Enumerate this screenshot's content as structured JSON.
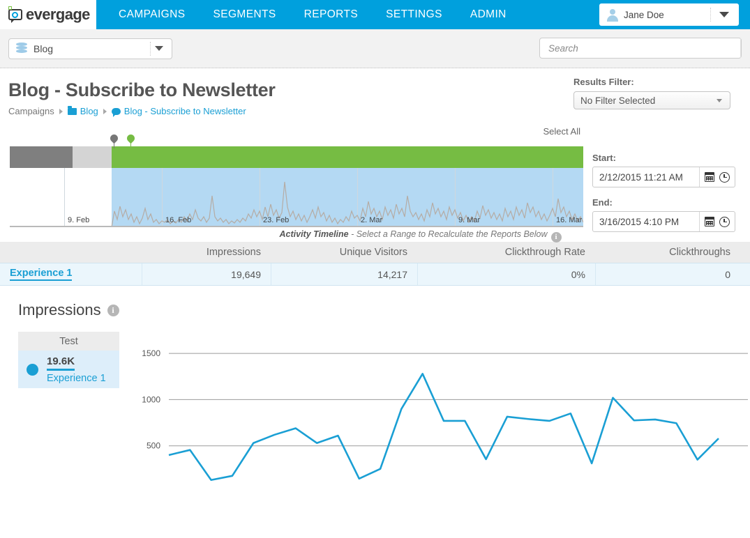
{
  "brand": {
    "name": "evergage",
    "accent": "#00a0dd",
    "green": "#7ac143"
  },
  "topnav": {
    "items": [
      "CAMPAIGNS",
      "SEGMENTS",
      "REPORTS",
      "SETTINGS",
      "ADMIN"
    ],
    "user": "Jane Doe"
  },
  "subbar": {
    "site": "Blog",
    "search_placeholder": "Search"
  },
  "page": {
    "title": "Blog - Subscribe to Newsletter",
    "breadcrumb": [
      "Campaigns",
      "Blog",
      "Blog - Subscribe to Newsletter"
    ]
  },
  "results_filter": {
    "label": "Results Filter:",
    "value": "No Filter Selected"
  },
  "timeline": {
    "select_all": "Select All",
    "caption_bold": "Activity Timeline",
    "caption_rest": " - Select a Range to Recalculate the Reports Below",
    "x_labels": [
      "9. Feb",
      "16. Feb",
      "23. Feb",
      "2. Mar",
      "9. Mar",
      "16. Mar"
    ],
    "start_label": "Start:",
    "start_value": "2/12/2015 11:21 AM",
    "end_label": "End:",
    "end_value": "3/16/2015 4:10 PM"
  },
  "results_table": {
    "columns": [
      "",
      "Impressions",
      "Unique Visitors",
      "Clickthrough Rate",
      "Clickthroughs"
    ],
    "rows": [
      {
        "name": "Experience 1",
        "impressions": "19,649",
        "unique_visitors": "14,217",
        "clickthrough_rate": "0%",
        "clickthroughs": "0"
      }
    ]
  },
  "impressions": {
    "title": "Impressions",
    "legend_header": "Test",
    "legend_value": "19.6K",
    "legend_name": "Experience 1"
  },
  "chart_data": {
    "type": "line",
    "title": "Impressions",
    "xlabel": "",
    "ylabel": "",
    "ylim": [
      0,
      1750
    ],
    "yticks": [
      500,
      1000,
      1500
    ],
    "grid": true,
    "legend_position": "left",
    "series": [
      {
        "name": "Experience 1",
        "color": "#1a9fd4",
        "values": [
          400,
          455,
          130,
          175,
          530,
          620,
          690,
          530,
          610,
          145,
          250,
          900,
          1280,
          770,
          770,
          355,
          815,
          790,
          770,
          850,
          310,
          1020,
          775,
          785,
          745,
          350,
          580
        ]
      }
    ]
  }
}
